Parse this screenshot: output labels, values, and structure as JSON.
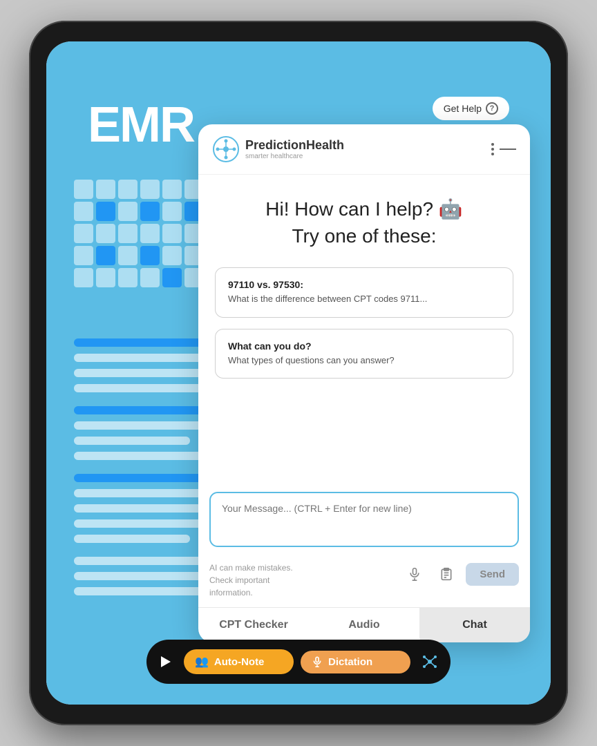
{
  "tablet": {
    "emr_title": "EMR",
    "get_help_label": "Get Help",
    "get_help_icon": "?"
  },
  "chat_panel": {
    "logo_name": "PredictionHealth",
    "logo_tagline": "smarter healthcare",
    "greeting_line1": "Hi! How can I help?",
    "greeting_line2": "Try one of these:",
    "suggestions": [
      {
        "title": "97110 vs. 97530:",
        "description": "What is the difference between CPT codes 9711..."
      },
      {
        "title": "What can you do?",
        "description": "What types of questions can you answer?"
      }
    ],
    "message_placeholder": "Your Message... (CTRL + Enter for new line)",
    "ai_disclaimer": "AI can make mistakes.\nCheck important\ninformation.",
    "send_label": "Send",
    "tabs": [
      {
        "label": "CPT Checker",
        "active": false
      },
      {
        "label": "Audio",
        "active": false
      },
      {
        "label": "Chat",
        "active": true
      }
    ]
  },
  "toolbar": {
    "auto_note_label": "Auto-Note",
    "dictation_label": "Dictation"
  }
}
